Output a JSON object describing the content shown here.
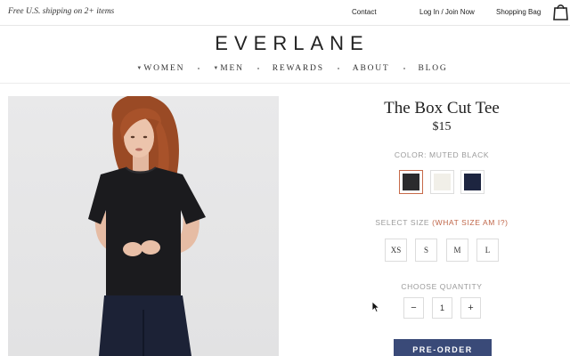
{
  "topbar": {
    "promo": "Free U.S. shipping on 2+ items",
    "contact": "Contact",
    "login": "Log In / Join Now",
    "bag": "Shopping Bag",
    "bag_icon": "shopping-bag-icon"
  },
  "logo": "EVERLANE",
  "nav": {
    "women": "WOMEN",
    "men": "MEN",
    "rewards": "REWARDS",
    "about": "ABOUT",
    "blog": "BLOG"
  },
  "product": {
    "title": "The Box Cut Tee",
    "price": "$15",
    "color_label": "COLOR: MUTED BLACK",
    "colors": [
      "#2b2b2d",
      "#f1efe8",
      "#1d2540"
    ],
    "size_label": "SELECT SIZE",
    "size_link": "(WHAT SIZE AM I?)",
    "sizes": [
      "XS",
      "S",
      "M",
      "L"
    ],
    "qty_label": "CHOOSE QUANTITY",
    "qty_minus": "−",
    "qty_value": "1",
    "qty_plus": "+",
    "cta": "PRE-ORDER"
  },
  "accent_colors": {
    "cta": "#3a4a78",
    "link": "#c0674a",
    "selected_swatch": "#c76a4a"
  }
}
